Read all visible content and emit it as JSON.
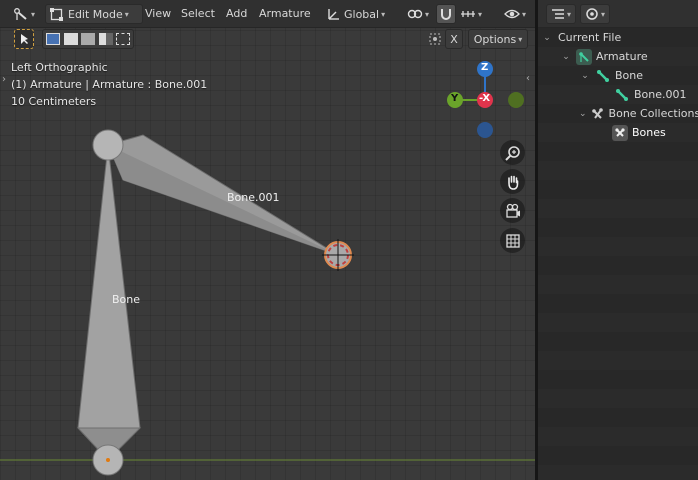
{
  "viewport_header": {
    "mode": "Edit Mode",
    "menus": [
      "View",
      "Select",
      "Add",
      "Armature"
    ],
    "transform_orientation": "Global"
  },
  "toolbar": {
    "xray_label": "X",
    "options_label": "Options"
  },
  "overlay_info": {
    "view_name": "Left Orthographic",
    "context": "(1) Armature | Armature : Bone.001",
    "scale": "10 Centimeters"
  },
  "gizmo": {
    "z_label": "Z",
    "y_label": "Y",
    "neg_x_label": "-X",
    "colors": {
      "z": "#2f74c9",
      "y": "#6aa32a",
      "x": "#e0344c"
    }
  },
  "bones": {
    "bone1_label": "Bone.001",
    "bone2_label": "Bone"
  },
  "outliner": {
    "items": [
      {
        "label": "Current File"
      },
      {
        "label": "Armature"
      },
      {
        "label": "Bone"
      },
      {
        "label": "Bone.001"
      },
      {
        "label": "Bone Collections"
      },
      {
        "label": "Bones"
      }
    ]
  }
}
